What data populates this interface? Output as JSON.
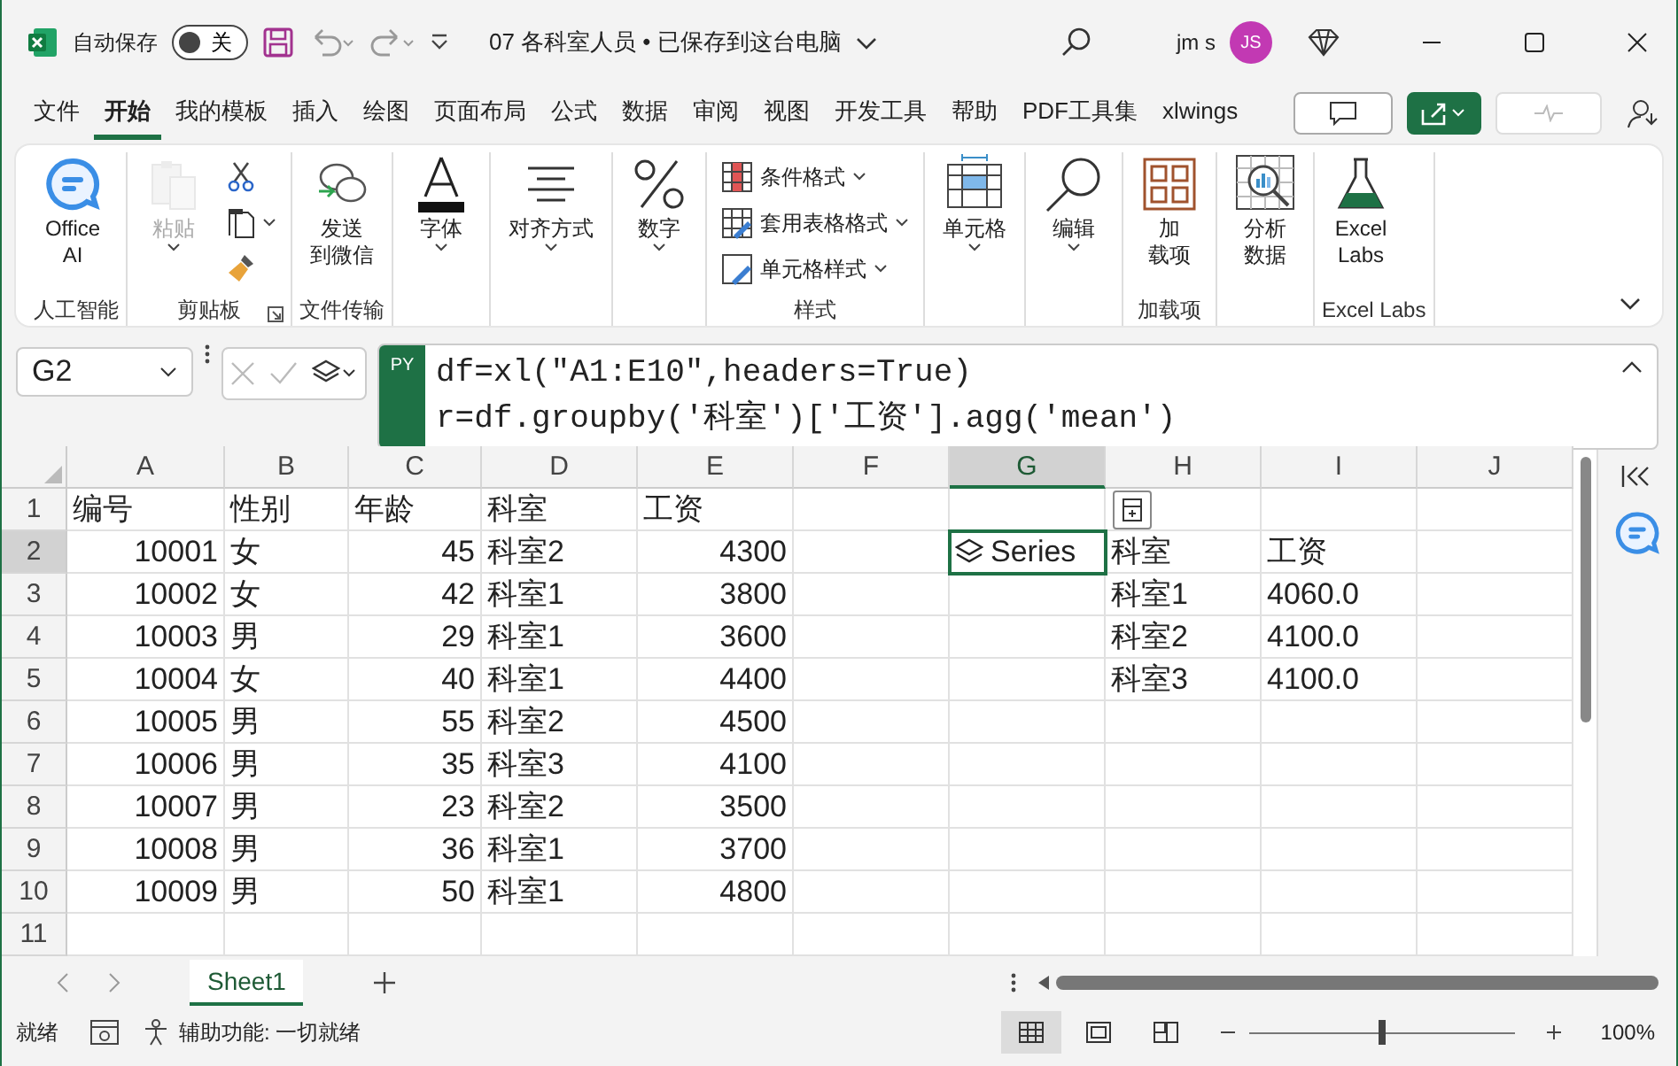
{
  "title_bar": {
    "autosave_label": "自动保存",
    "autosave": {
      "on": false,
      "label": "关"
    },
    "document_title": "07 各科室人员 • 已保存到这台电脑",
    "user_name": "jm s",
    "avatar": "JS"
  },
  "menu_tabs": [
    {
      "label": "文件",
      "selected": false
    },
    {
      "label": "开始",
      "selected": true
    },
    {
      "label": "我的模板",
      "selected": false
    },
    {
      "label": "插入",
      "selected": false
    },
    {
      "label": "绘图",
      "selected": false
    },
    {
      "label": "页面布局",
      "selected": false
    },
    {
      "label": "公式",
      "selected": false
    },
    {
      "label": "数据",
      "selected": false
    },
    {
      "label": "审阅",
      "selected": false
    },
    {
      "label": "视图",
      "selected": false
    },
    {
      "label": "开发工具",
      "selected": false
    },
    {
      "label": "帮助",
      "selected": false
    },
    {
      "label": "PDF工具集",
      "selected": false
    },
    {
      "label": "xlwings",
      "selected": false
    }
  ],
  "ribbon": {
    "groups": [
      {
        "label": "人工智能",
        "items": [
          {
            "kind": "large",
            "lines": [
              "Office",
              "AI"
            ],
            "caret": false,
            "disabled": false
          }
        ]
      },
      {
        "label": "剪贴板",
        "launcher": true,
        "items": [
          {
            "kind": "large",
            "lines": [
              "粘贴"
            ],
            "caret": true,
            "disabled": true
          },
          {
            "kind": "icon",
            "caret": false,
            "disabled": false
          },
          {
            "kind": "icon",
            "caret": true,
            "disabled": false
          },
          {
            "kind": "icon",
            "caret": false,
            "disabled": false
          }
        ]
      },
      {
        "label": "文件传输",
        "items": [
          {
            "kind": "large",
            "lines": [
              "发送",
              "到微信"
            ],
            "caret": false,
            "disabled": false
          }
        ]
      },
      {
        "items": [
          {
            "kind": "large",
            "lines": [
              "字体"
            ],
            "caret": true,
            "disabled": false
          }
        ]
      },
      {
        "items": [
          {
            "kind": "large",
            "lines": [
              "对齐方式"
            ],
            "caret": true,
            "disabled": false
          }
        ]
      },
      {
        "items": [
          {
            "kind": "large",
            "lines": [
              "数字"
            ],
            "caret": true,
            "disabled": false
          }
        ]
      },
      {
        "label": "样式",
        "items": [
          {
            "kind": "small",
            "lines": [
              "条件格式"
            ],
            "caret": true,
            "disabled": false
          },
          {
            "kind": "small",
            "lines": [
              "套用表格格式"
            ],
            "caret": true,
            "disabled": false
          },
          {
            "kind": "small",
            "lines": [
              "单元格样式"
            ],
            "caret": true,
            "disabled": false
          }
        ]
      },
      {
        "items": [
          {
            "kind": "large",
            "lines": [
              "单元格"
            ],
            "caret": true,
            "disabled": false
          }
        ]
      },
      {
        "items": [
          {
            "kind": "large",
            "lines": [
              "编辑"
            ],
            "caret": true,
            "disabled": false
          }
        ]
      },
      {
        "label": "加载项",
        "items": [
          {
            "kind": "large",
            "lines": [
              "加",
              "载项"
            ],
            "caret": false,
            "disabled": false
          }
        ]
      },
      {
        "items": [
          {
            "kind": "large",
            "lines": [
              "分析",
              "数据"
            ],
            "caret": false,
            "disabled": false
          }
        ]
      },
      {
        "label": "Excel Labs",
        "items": [
          {
            "kind": "large",
            "lines": [
              "Excel",
              "Labs"
            ],
            "caret": false,
            "disabled": false
          }
        ]
      }
    ]
  },
  "formula_bar": {
    "name_box": "G2",
    "badge": "PY",
    "lines": [
      "df=xl(\"A1:E10\",headers=True)",
      "r=df.groupby('科室')['工资'].agg('mean')"
    ]
  },
  "sheet": {
    "columns": [
      {
        "label": "A",
        "selected": false
      },
      {
        "label": "B",
        "selected": false
      },
      {
        "label": "C",
        "selected": false
      },
      {
        "label": "D",
        "selected": false
      },
      {
        "label": "E",
        "selected": false
      },
      {
        "label": "F",
        "selected": false
      },
      {
        "label": "G",
        "selected": true
      },
      {
        "label": "H",
        "selected": false
      },
      {
        "label": "I",
        "selected": false
      },
      {
        "label": "J",
        "selected": false
      }
    ],
    "rows": [
      {
        "label": "1",
        "selected": false,
        "cells": [
          "编号",
          "性别",
          "年龄",
          "科室",
          "工资",
          "",
          "",
          "",
          "",
          ""
        ]
      },
      {
        "label": "2",
        "selected": true,
        "cells": [
          "10001",
          "女",
          "45",
          "科室2",
          "4300",
          "",
          {
            "kind": "python",
            "text": "Series"
          },
          "科室",
          "工资",
          ""
        ]
      },
      {
        "label": "3",
        "selected": false,
        "cells": [
          "10002",
          "女",
          "42",
          "科室1",
          "3800",
          "",
          "",
          "科室1",
          "4060.0",
          ""
        ]
      },
      {
        "label": "4",
        "selected": false,
        "cells": [
          "10003",
          "男",
          "29",
          "科室1",
          "3600",
          "",
          "",
          "科室2",
          "4100.0",
          ""
        ]
      },
      {
        "label": "5",
        "selected": false,
        "cells": [
          "10004",
          "女",
          "40",
          "科室1",
          "4400",
          "",
          "",
          "科室3",
          "4100.0",
          ""
        ]
      },
      {
        "label": "6",
        "selected": false,
        "cells": [
          "10005",
          "男",
          "55",
          "科室2",
          "4500",
          "",
          "",
          "",
          "",
          ""
        ]
      },
      {
        "label": "7",
        "selected": false,
        "cells": [
          "10006",
          "男",
          "35",
          "科室3",
          "4100",
          "",
          "",
          "",
          "",
          ""
        ]
      },
      {
        "label": "8",
        "selected": false,
        "cells": [
          "10007",
          "男",
          "23",
          "科室2",
          "3500",
          "",
          "",
          "",
          "",
          ""
        ]
      },
      {
        "label": "9",
        "selected": false,
        "cells": [
          "10008",
          "男",
          "36",
          "科室1",
          "3700",
          "",
          "",
          "",
          "",
          ""
        ]
      },
      {
        "label": "10",
        "selected": false,
        "cells": [
          "10009",
          "男",
          "50",
          "科室1",
          "4800",
          "",
          "",
          "",
          "",
          ""
        ]
      },
      {
        "label": "11",
        "selected": false,
        "cells": [
          "",
          "",
          "",
          "",
          "",
          "",
          "",
          "",
          "",
          ""
        ]
      }
    ]
  },
  "sheet_tabs": [
    {
      "label": "Sheet1",
      "selected": true
    }
  ],
  "status_bar": {
    "status": "就绪",
    "accessibility": "辅助功能: 一切就绪",
    "views": [
      {
        "kind": "normal",
        "selected": true
      },
      {
        "kind": "page_layout",
        "selected": false
      },
      {
        "kind": "page_break",
        "selected": false
      }
    ],
    "zoom": {
      "level": 0.5,
      "label": "100%"
    }
  }
}
